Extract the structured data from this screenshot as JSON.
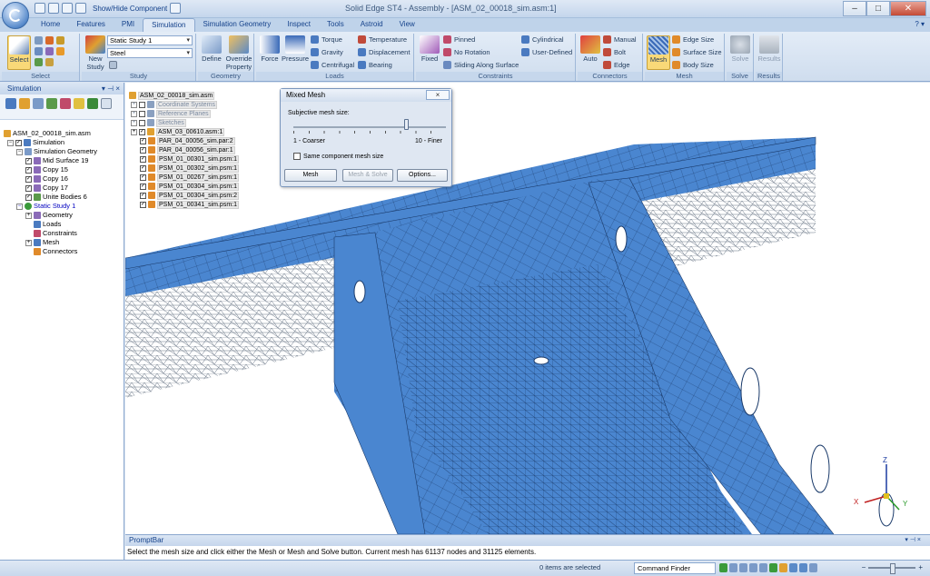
{
  "window": {
    "title": "Solid Edge ST4 - Assembly - [ASM_02_00018_sim.asm:1]",
    "qat_label": "Show/Hide Component",
    "help": "? ▾"
  },
  "tabs": [
    "Home",
    "Features",
    "PMI",
    "Simulation",
    "Simulation Geometry",
    "Inspect",
    "Tools",
    "Astroid",
    "View"
  ],
  "ribbon": {
    "select": {
      "label": "Select",
      "group": "Select"
    },
    "study": {
      "new_label": "New Study",
      "study_value": "Static Study 1",
      "material_value": "Steel",
      "group": "Study"
    },
    "geometry": {
      "define": "Define",
      "override": "Override Property",
      "group": "Geometry"
    },
    "loads": {
      "force": "Force",
      "pressure": "Pressure",
      "torque": "Torque",
      "gravity": "Gravity",
      "centrifugal": "Centrifugal",
      "temperature": "Temperature",
      "displacement": "Displacement",
      "bearing": "Bearing",
      "group": "Loads"
    },
    "constraints": {
      "fixed": "Fixed",
      "pinned": "Pinned",
      "no_rotation": "No Rotation",
      "sliding": "Sliding Along Surface",
      "cylindrical": "Cylindrical",
      "user_defined": "User-Defined",
      "group": "Constraints"
    },
    "connectors": {
      "auto": "Auto",
      "manual": "Manual",
      "bolt": "Bolt",
      "edge": "Edge",
      "group": "Connectors"
    },
    "mesh": {
      "mesh": "Mesh",
      "edge_size": "Edge Size",
      "surface_size": "Surface Size",
      "body_size": "Body Size",
      "group": "Mesh"
    },
    "solve": {
      "solve": "Solve",
      "group": "Solve"
    },
    "results": {
      "results": "Results",
      "group": "Results"
    }
  },
  "left_panel": {
    "title": "Simulation",
    "controls": "▾ ⊣ ×",
    "tree": [
      {
        "label": "ASM_02_00018_sim.asm",
        "indent": 0
      },
      {
        "label": "Simulation",
        "indent": 1
      },
      {
        "label": "Simulation Geometry",
        "indent": 2
      },
      {
        "label": "Mid Surface 19",
        "indent": 3
      },
      {
        "label": "Copy 15",
        "indent": 3
      },
      {
        "label": "Copy 16",
        "indent": 3
      },
      {
        "label": "Copy 17",
        "indent": 3
      },
      {
        "label": "Unite Bodies 6",
        "indent": 3
      },
      {
        "label": "Static Study 1",
        "indent": 2
      },
      {
        "label": "Geometry",
        "indent": 3
      },
      {
        "label": "Loads",
        "indent": 3
      },
      {
        "label": "Constraints",
        "indent": 3
      },
      {
        "label": "Mesh",
        "indent": 3
      },
      {
        "label": "Connectors",
        "indent": 3
      }
    ]
  },
  "viewport_tree": [
    "ASM_02_00018_sim.asm",
    "Coordinate Systems",
    "Reference Planes",
    "Sketches",
    "ASM_03_00610.asm:1",
    "PAR_04_00056_sim.par:2",
    "PAR_04_00056_sim.par:1",
    "PSM_01_00301_sim.psm:1",
    "PSM_01_00302_sim.psm:1",
    "PSM_01_00267_sim.psm:1",
    "PSM_01_00304_sim.psm:1",
    "PSM_01_00304_sim.psm:2",
    "PSM_01_00341_sim.psm:1"
  ],
  "dialog": {
    "title": "Mixed Mesh",
    "close": "×",
    "size_label": "Subjective mesh size:",
    "coarse": "1 - Coarser",
    "fine": "10 - Finer",
    "checkbox": "Same component mesh size",
    "mesh_btn": "Mesh",
    "mesh_solve_btn": "Mesh & Solve",
    "options_btn": "Options...",
    "slider_value": 8
  },
  "axes": {
    "z": "Z",
    "y": "Y",
    "x": "X"
  },
  "prompt": {
    "title": "PromptBar",
    "controls": "▾ ⊣ ×",
    "text": "Select the mesh size and click either the Mesh or Mesh and Solve button. Current mesh has 61137 nodes and 31125 elements."
  },
  "status": {
    "items": "0 items are selected",
    "command_finder": "Command Finder"
  },
  "colors": {
    "mesh_blue": "#4a86d0",
    "mesh_line": "#1a3a6a",
    "ribbon": "#dbe5f1"
  }
}
